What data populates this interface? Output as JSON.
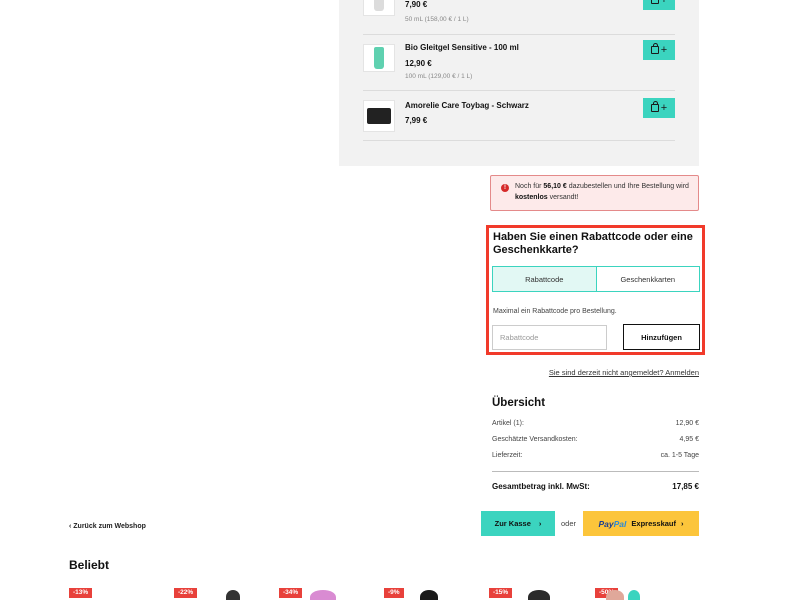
{
  "upsell": {
    "items": [
      {
        "title": "",
        "price": "7,90 €",
        "unit": "50 mL (158,00 € / 1 L)",
        "thumb": "white-tube"
      },
      {
        "title": "Bio Gleitgel Sensitive - 100 ml",
        "price": "12,90 €",
        "unit": "100 mL (129,00 € / 1 L)",
        "thumb": "green-tube"
      },
      {
        "title": "Amorelie Care Toybag - Schwarz",
        "price": "7,99 €",
        "unit": "",
        "thumb": "black-bag"
      }
    ],
    "add_icon": "shopping-bag-icon",
    "add_plus": "+"
  },
  "notice": {
    "icon": "!",
    "text_before": "Noch für ",
    "amount": "56,10 €",
    "text_middle": " dazubestellen und Ihre Bestellung wird ",
    "highlight": "kostenlos",
    "text_after": " versandt!"
  },
  "voucher": {
    "title": "Haben Sie einen Rabattcode oder eine Geschenkkarte?",
    "tabs": [
      "Rabattcode",
      "Geschenkkarten"
    ],
    "hint": "Maximal ein Rabattcode pro Bestellung.",
    "input_placeholder": "Rabattcode",
    "add_button": "Hinzufügen"
  },
  "login_link": "Sie sind derzeit nicht angemeldet? Anmelden",
  "summary": {
    "title": "Übersicht",
    "rows": [
      {
        "label": "Artikel (1):",
        "value": "12,90 €"
      },
      {
        "label": "Geschätzte Versandkosten:",
        "value": "4,95 €"
      },
      {
        "label": "Lieferzeit:",
        "value": "ca. 1-5 Tage"
      }
    ],
    "total_label": "Gesamtbetrag inkl. MwSt:",
    "total_value": "17,85 €"
  },
  "checkout": {
    "button": "Zur Kasse",
    "or": "oder",
    "paypal_pay": "Pay",
    "paypal_pal": "Pal",
    "paypal_label": "Expresskauf"
  },
  "back_link": "Zurück zum Webshop",
  "popular": {
    "title": "Beliebt",
    "badges": [
      "-13%",
      "-22%",
      "-34%",
      "-9%",
      "-15%",
      "-50%"
    ]
  },
  "colors": {
    "accent": "#3bd4bf",
    "highlight_border": "#f13a2a",
    "paypal": "#fcc53b",
    "sale": "#e8413b"
  }
}
